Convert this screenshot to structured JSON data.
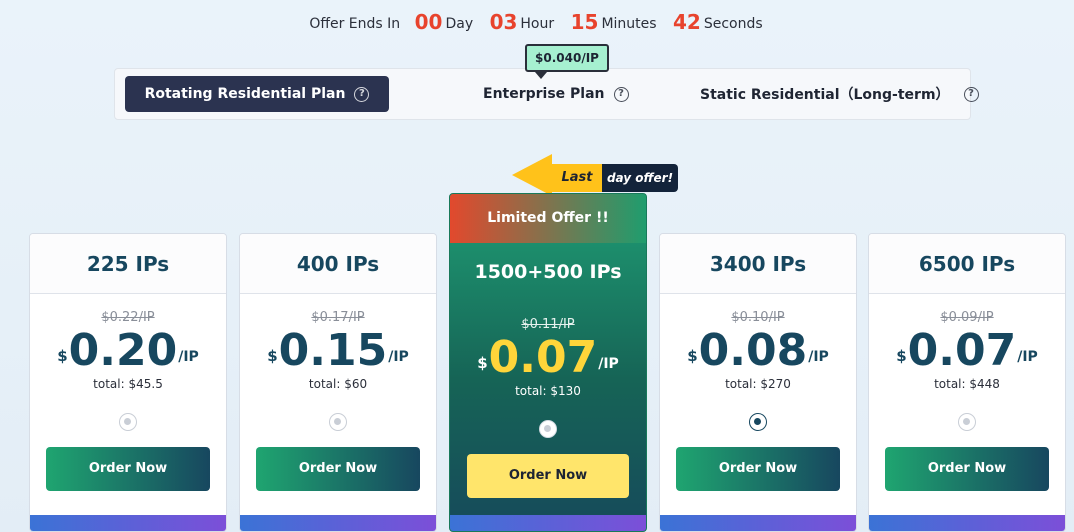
{
  "countdown": {
    "prefix": "Offer Ends In",
    "days": "00",
    "days_label": "Day",
    "hours": "03",
    "hours_label": "Hour",
    "minutes": "15",
    "minutes_label": "Minutes",
    "seconds": "42",
    "seconds_label": "Seconds"
  },
  "enterprise_tag": "$0.040/IP",
  "tabs": [
    {
      "label": "Rotating Residential Plan",
      "active": true
    },
    {
      "label": "Enterprise Plan",
      "active": false
    },
    {
      "label": "Static Residential（Long-term）",
      "active": false
    }
  ],
  "help_glyph": "?",
  "ribbon": {
    "left": "Last",
    "right": "day offer!"
  },
  "plans": [
    {
      "title": "225 IPs",
      "old_price": "$0.22/IP",
      "currency": "$",
      "price": "0.20",
      "per": "/IP",
      "total": "total:  $45.5",
      "selected": false,
      "cta": "Order Now"
    },
    {
      "title": "400 IPs",
      "old_price": "$0.17/IP",
      "currency": "$",
      "price": "0.15",
      "per": "/IP",
      "total": "total:  $60",
      "selected": false,
      "cta": "Order Now"
    },
    {
      "title": "1500+500 IPs",
      "badge": "Limited Offer !!",
      "old_price": "$0.11/IP",
      "currency": "$",
      "price": "0.07",
      "per": "/IP",
      "total": "total:  $130",
      "selected": false,
      "cta": "Order Now"
    },
    {
      "title": "3400 IPs",
      "old_price": "$0.10/IP",
      "currency": "$",
      "price": "0.08",
      "per": "/IP",
      "total": "total:  $270",
      "selected": true,
      "cta": "Order Now"
    },
    {
      "title": "6500 IPs",
      "old_price": "$0.09/IP",
      "currency": "$",
      "price": "0.07",
      "per": "/IP",
      "total": "total:  $448",
      "selected": false,
      "cta": "Order Now"
    }
  ],
  "colors": {
    "countdown_number": "#e8432d",
    "active_tab": "#2b3350",
    "price_text": "#17475f",
    "featured_price": "#ffd53a"
  }
}
